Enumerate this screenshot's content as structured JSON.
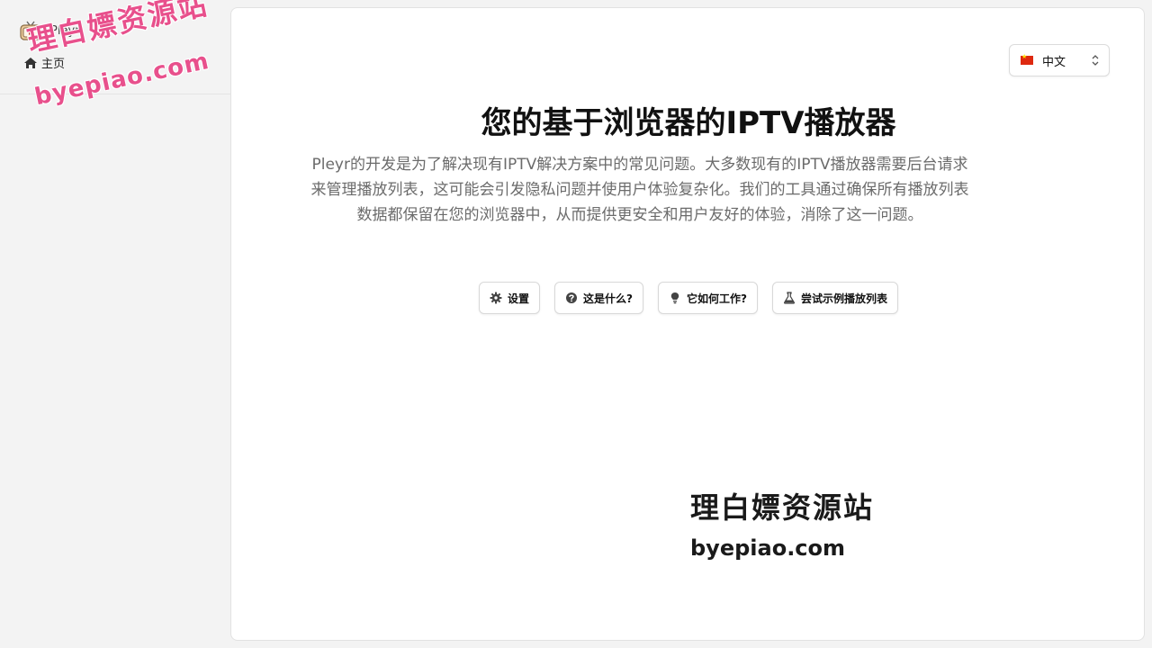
{
  "sidebar": {
    "brand": "Pleyr",
    "nav": [
      {
        "label": "主页",
        "icon": "home-icon"
      }
    ]
  },
  "header": {
    "language": {
      "selected": "中文",
      "icon": "china-flag-icon"
    }
  },
  "main": {
    "title": "您的基于浏览器的IPTV播放器",
    "description": "Pleyr的开发是为了解决现有IPTV解决方案中的常见问题。大多数现有的IPTV播放器需要后台请求来管理播放列表，这可能会引发隐私问题并使用户体验复杂化。我们的工具通过确保所有播放列表数据都保留在您的浏览器中，从而提供更安全和用户友好的体验，消除了这一问题。",
    "buttons": [
      {
        "label": "设置",
        "icon": "gear-icon"
      },
      {
        "label": "这是什么?",
        "icon": "question-icon"
      },
      {
        "label": "它如何工作?",
        "icon": "lightbulb-icon"
      },
      {
        "label": "尝试示例播放列表",
        "icon": "flask-icon"
      }
    ]
  },
  "watermarks": {
    "top_line1": "理白嫖资源站",
    "top_line2": "byepiao.com",
    "center_line1": "理白嫖资源站",
    "center_line2": "byepiao.com"
  },
  "colors": {
    "watermark_pink": "#e8508c",
    "text_primary": "#111111",
    "text_muted": "#6b6b6b",
    "background": "#f3f3f3",
    "panel": "#ffffff"
  }
}
